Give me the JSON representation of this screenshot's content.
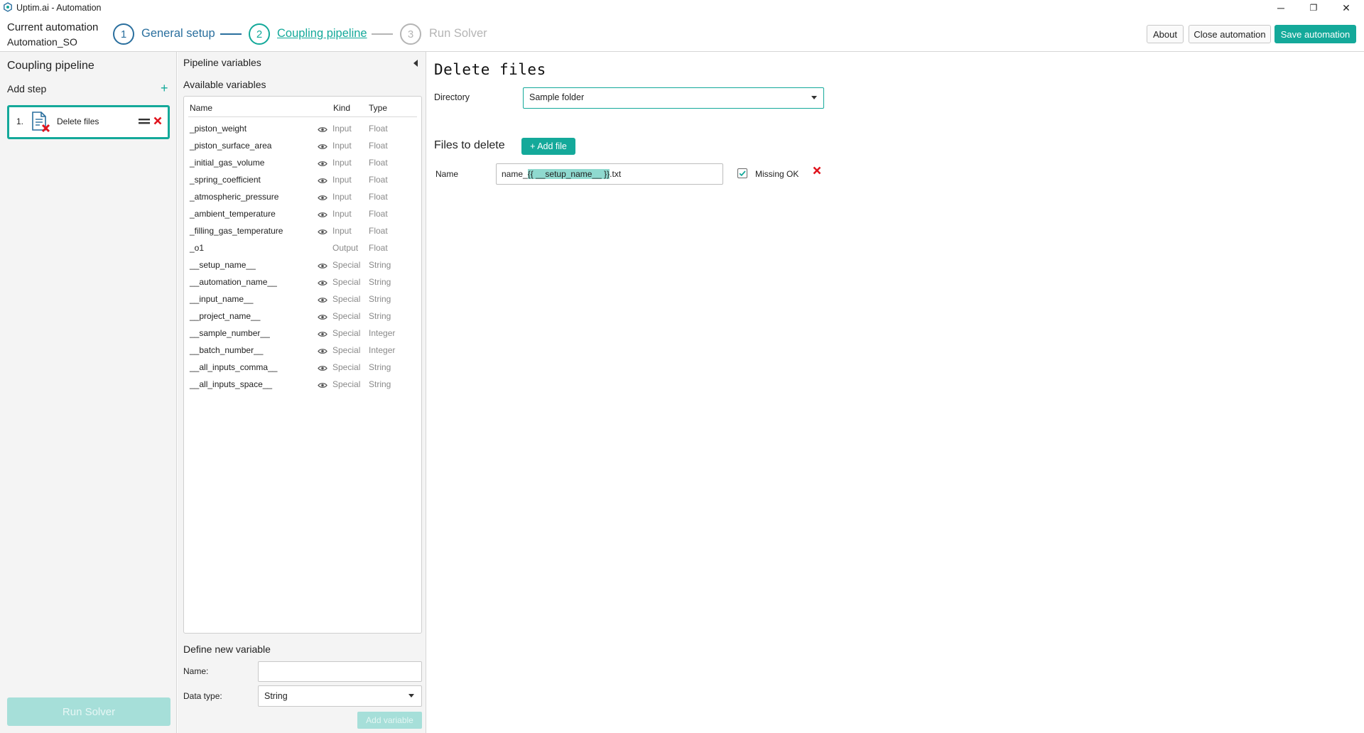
{
  "window": {
    "title": "Uptim.ai - Automation",
    "controls": {
      "minimize": "─",
      "restore": "❐",
      "close": "✕"
    }
  },
  "header": {
    "current_automation_label": "Current automation",
    "current_automation_name": "Automation_SO",
    "steps": [
      {
        "number": "1",
        "label": "General setup",
        "state": "done"
      },
      {
        "number": "2",
        "label": "Coupling pipeline",
        "state": "active"
      },
      {
        "number": "3",
        "label": "Run Solver",
        "state": "inactive"
      }
    ],
    "buttons": {
      "about": "About",
      "close": "Close automation",
      "save": "Save automation"
    }
  },
  "left_panel": {
    "title": "Coupling pipeline",
    "add_step_label": "Add step",
    "add_icon": "+",
    "steps": [
      {
        "index": "1.",
        "label": "Delete files",
        "icon": "delete-file-icon"
      }
    ],
    "run_solver_label": "Run Solver"
  },
  "pipeline_panel": {
    "title": "Pipeline variables",
    "available_title": "Available variables",
    "columns": {
      "name": "Name",
      "kind": "Kind",
      "type": "Type"
    },
    "variables": [
      {
        "name": "_piston_weight",
        "kind": "Input",
        "type": "Float",
        "visible": true
      },
      {
        "name": "_piston_surface_area",
        "kind": "Input",
        "type": "Float",
        "visible": true
      },
      {
        "name": "_initial_gas_volume",
        "kind": "Input",
        "type": "Float",
        "visible": true
      },
      {
        "name": "_spring_coefficient",
        "kind": "Input",
        "type": "Float",
        "visible": true
      },
      {
        "name": "_atmospheric_pressure",
        "kind": "Input",
        "type": "Float",
        "visible": true
      },
      {
        "name": "_ambient_temperature",
        "kind": "Input",
        "type": "Float",
        "visible": true
      },
      {
        "name": "_filling_gas_temperature",
        "kind": "Input",
        "type": "Float",
        "visible": true
      },
      {
        "name": "_o1",
        "kind": "Output",
        "type": "Float",
        "visible": false
      },
      {
        "name": "__setup_name__",
        "kind": "Special",
        "type": "String",
        "visible": true
      },
      {
        "name": "__automation_name__",
        "kind": "Special",
        "type": "String",
        "visible": true
      },
      {
        "name": "__input_name__",
        "kind": "Special",
        "type": "String",
        "visible": true
      },
      {
        "name": "__project_name__",
        "kind": "Special",
        "type": "String",
        "visible": true
      },
      {
        "name": "__sample_number__",
        "kind": "Special",
        "type": "Integer",
        "visible": true
      },
      {
        "name": "__batch_number__",
        "kind": "Special",
        "type": "Integer",
        "visible": true
      },
      {
        "name": "__all_inputs_comma__",
        "kind": "Special",
        "type": "String",
        "visible": true
      },
      {
        "name": "__all_inputs_space__",
        "kind": "Special",
        "type": "String",
        "visible": true
      }
    ],
    "define": {
      "title": "Define new variable",
      "name_label": "Name:",
      "name_value": "",
      "type_label": "Data type:",
      "type_value": "String",
      "add_label": "Add variable"
    }
  },
  "editor": {
    "title": "Delete files",
    "directory_label": "Directory",
    "directory_value": "Sample folder",
    "files_title": "Files to delete",
    "add_file_label": "+ Add file",
    "file_row": {
      "name_label": "Name",
      "value_prefix": "name_",
      "value_highlight": "{{ __setup_name__ }}",
      "value_suffix": ".txt",
      "missing_ok_label": "Missing OK",
      "missing_ok_checked": true
    }
  },
  "colors": {
    "accent": "#14a99a",
    "step_done": "#2a6f9e",
    "disabled_accent": "#a6dfd9",
    "remove": "#e0141e"
  }
}
